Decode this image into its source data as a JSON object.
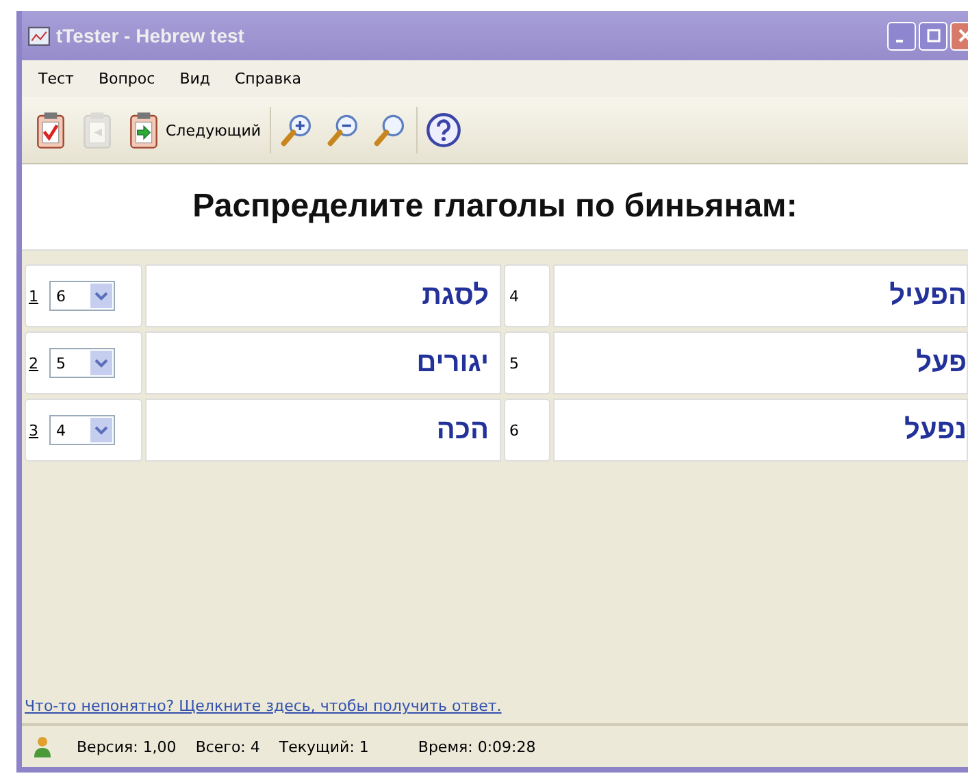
{
  "window": {
    "title": "tTester - Hebrew test"
  },
  "menu": {
    "test": "Тест",
    "question": "Вопрос",
    "view": "Вид",
    "help": "Справка"
  },
  "toolbar": [
    {
      "kind": "clipboard-check",
      "disabled": false
    },
    {
      "kind": "back",
      "disabled": true
    },
    {
      "kind": "next",
      "disabled": false,
      "label": "Следующий"
    },
    {
      "kind": "separator"
    },
    {
      "kind": "zoom-in",
      "disabled": false
    },
    {
      "kind": "zoom-out",
      "disabled": false
    },
    {
      "kind": "zoom",
      "disabled": false
    },
    {
      "kind": "separator"
    },
    {
      "kind": "help",
      "disabled": false
    }
  ],
  "question": "Распределите глаголы по биньянам:",
  "rows": [
    {
      "number": "1",
      "choice": "6",
      "word": "לסגת",
      "option_number": "4",
      "option": "הפעיל"
    },
    {
      "number": "2",
      "choice": "5",
      "word": "יגורים",
      "option_number": "5",
      "option": "פעל"
    },
    {
      "number": "3",
      "choice": "4",
      "word": "הכה",
      "option_number": "6",
      "option": "נפעל"
    }
  ],
  "help_link": "Что-то непонятно? Щелкните здесь, чтобы получить ответ.",
  "status_bar": {
    "version": "Версия: 1,00",
    "total": "Всего: 4",
    "current": "Текущий: 1",
    "time": "Время: 0:09:28"
  }
}
